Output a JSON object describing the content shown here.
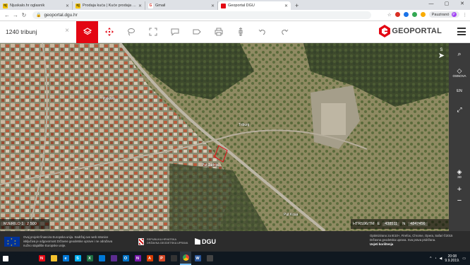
{
  "browser": {
    "tabs": [
      {
        "title": "Njuskalo.hr oglasnik",
        "favicon_color": "#f5c400",
        "favicon_text": "nj",
        "active": false
      },
      {
        "title": "Prodaja kuća | Kuće prodaja - oc...",
        "favicon_color": "#f5c400",
        "favicon_text": "nj",
        "active": false
      },
      {
        "title": "Gmail",
        "favicon_color": "#ffffff",
        "favicon_text": "G",
        "active": false
      },
      {
        "title": "Geoportal DGU",
        "favicon_color": "#e30613",
        "favicon_text": "",
        "active": true
      }
    ],
    "new_tab": "+",
    "url": "geoportal.dgu.hr",
    "profile_label": "Pauziranó",
    "profile_initial": "P"
  },
  "toolbar": {
    "search_value": "1240 tribunj",
    "search_clear": "×",
    "logo_text": "GEOPORTAL",
    "accent_color": "#e30613"
  },
  "map": {
    "labels": [
      {
        "text": "Tribunj"
      },
      {
        "text": "Put Jadrija"
      },
      {
        "text": "Pakovo"
      },
      {
        "text": "Put Kosa"
      }
    ]
  },
  "right_panel": {
    "items": [
      {
        "icon": "layers-icon",
        "label": "OSNOVA"
      },
      {
        "icon": "language-icon",
        "label": "EN"
      },
      {
        "icon": "fullscreen-icon",
        "label": ""
      },
      {
        "icon": "3d-icon",
        "label": "3D"
      }
    ],
    "zoom_in": "+",
    "zoom_out": "−"
  },
  "north_label": "S",
  "scale": {
    "label": "MJERILO 1 : 2 500"
  },
  "coords": {
    "crs": "HTRS96/TM",
    "e_label": "E",
    "e_value": "438511",
    "n_label": "N",
    "n_value": "4847456"
  },
  "footer": {
    "eu_text": "Ovaj projekt financira Europska unija. Sadržaj ove web stranice isključiva je odgovornost Državne geodetske uprave i ne odražava nužno stajalište Europske unije.",
    "hr_text": "REPUBLIKA HRVATSKA DRŽAVNA GEODETSKA UPRAVA",
    "dgu_text": "DGU",
    "right_text": "Optimizirano za IE10+, Firefox, Chrome, Opera, Safari ©2015 Državna geodetska uprava. Sva prava pridržana.",
    "terms": "Uvjeti korištenja"
  },
  "taskbar": {
    "time": "20:08",
    "date": "9.9.2019.",
    "apps": [
      {
        "name": "start",
        "color": "#ffffff",
        "text": ""
      },
      {
        "name": "search",
        "color": "#101820",
        "text": ""
      },
      {
        "name": "task-view",
        "color": "#101820",
        "text": ""
      },
      {
        "name": "netflix",
        "color": "#e50914",
        "text": "N"
      },
      {
        "name": "explorer",
        "color": "#f2c12e",
        "text": ""
      },
      {
        "name": "edge",
        "color": "#0078d7",
        "text": "e"
      },
      {
        "name": "skype",
        "color": "#00aff0",
        "text": "S"
      },
      {
        "name": "excel",
        "color": "#1d6f42",
        "text": "X"
      },
      {
        "name": "mail",
        "color": "#0078d7",
        "text": ""
      },
      {
        "name": "photos",
        "color": "#5c2d91",
        "text": ""
      },
      {
        "name": "outlook",
        "color": "#0072c6",
        "text": "O"
      },
      {
        "name": "onenote",
        "color": "#7719aa",
        "text": "N"
      },
      {
        "name": "acrobat",
        "color": "#d83b01",
        "text": "A"
      },
      {
        "name": "powerpoint",
        "color": "#d24726",
        "text": "P"
      },
      {
        "name": "app-camera",
        "color": "#333333",
        "text": ""
      },
      {
        "name": "chrome",
        "color": "#ea4335",
        "text": ""
      },
      {
        "name": "word",
        "color": "#2b579a",
        "text": "W"
      },
      {
        "name": "photos2",
        "color": "#444444",
        "text": ""
      }
    ]
  }
}
